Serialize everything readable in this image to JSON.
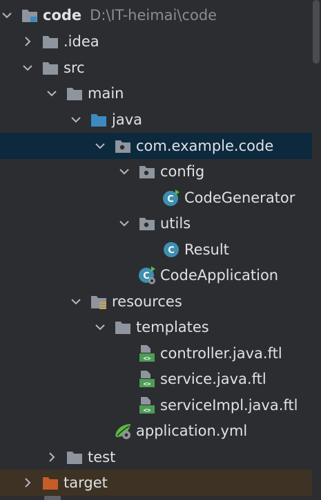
{
  "tree": {
    "root": {
      "label": "code",
      "path": "D:\\IT-heimai\\code"
    },
    "idea": ".idea",
    "src": "src",
    "main": "main",
    "java": "java",
    "package": "com.example.code",
    "config": "config",
    "code_generator": "CodeGenerator",
    "utils": "utils",
    "result": "Result",
    "code_application": "CodeApplication",
    "resources": "resources",
    "templates": "templates",
    "controller_tpl": "controller.java.ftl",
    "service_tpl": "service.java.ftl",
    "service_impl_tpl": "serviceImpl.java.ftl",
    "application_yml": "application.yml",
    "test": "test",
    "target": "target"
  },
  "colors": {
    "background": "#2b2d30",
    "selected_row": "#0d293e",
    "excluded_row": "#3d3223",
    "folder": "#8e959e",
    "source_folder": "#3d8ac0",
    "excluded_folder": "#c65c27",
    "class_icon": "#3e8fb0",
    "template_icon": "#4d9c57"
  }
}
